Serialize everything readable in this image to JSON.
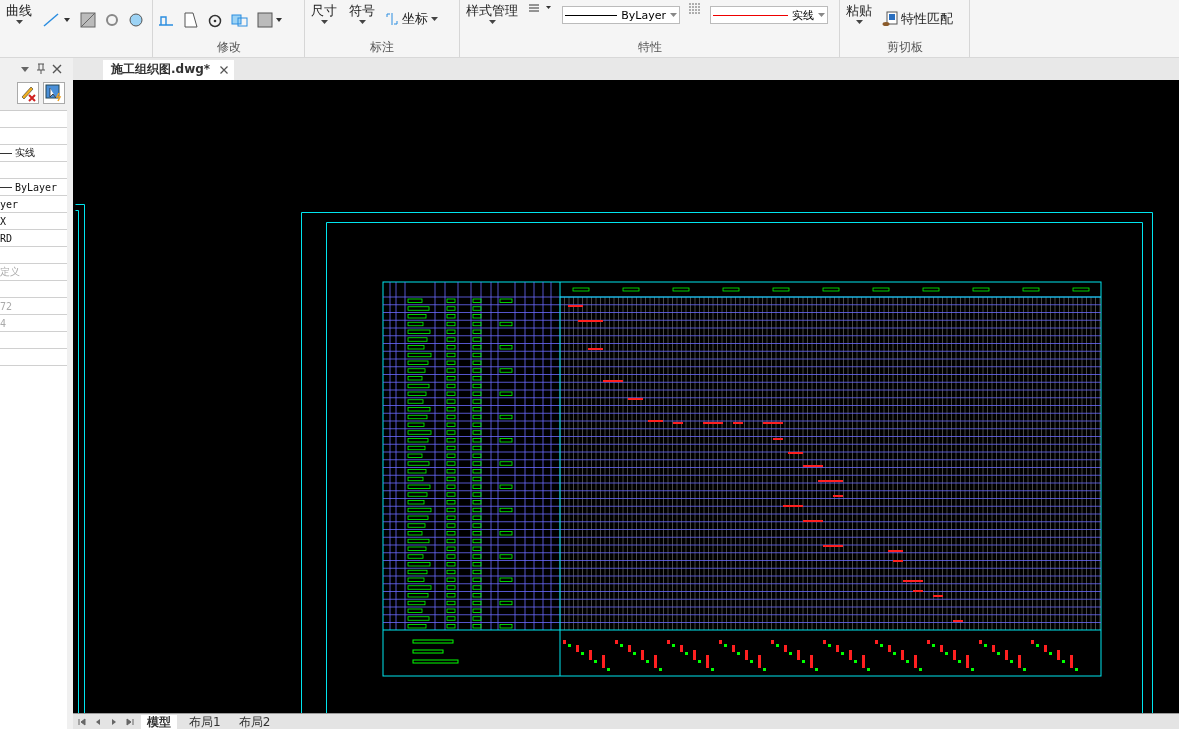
{
  "ribbon": {
    "groups": [
      {
        "kind": "draw",
        "big": "曲线"
      },
      {
        "kind": "modify",
        "label": "修改"
      },
      {
        "kind": "annotate",
        "label": "标注",
        "big": [
          "尺寸",
          "符号"
        ],
        "small": "坐标"
      },
      {
        "kind": "properties",
        "label": "特性",
        "big": "样式管理",
        "lineweight": "ByLayer",
        "linetype": "实线"
      },
      {
        "kind": "clipboard",
        "label": "剪切板",
        "big": "粘贴",
        "small": "特性匹配"
      }
    ]
  },
  "document_tab": {
    "title": "施工组织图.dwg*"
  },
  "properties_panel": {
    "rows": [
      {
        "kind": "blank"
      },
      {
        "kind": "blank"
      },
      {
        "kind": "line",
        "value": "实线",
        "muted": false
      },
      {
        "kind": "blank"
      },
      {
        "kind": "line",
        "value": "ByLayer",
        "muted": false
      },
      {
        "kind": "text",
        "value": "yer",
        "muted": false
      },
      {
        "kind": "text",
        "value": "X",
        "muted": false
      },
      {
        "kind": "text",
        "value": "RD",
        "muted": false
      },
      {
        "kind": "blank"
      },
      {
        "kind": "text",
        "value": "定义",
        "muted": true
      },
      {
        "kind": "blank"
      },
      {
        "kind": "text",
        "value": "72",
        "muted": true
      },
      {
        "kind": "text",
        "value": "4",
        "muted": true
      },
      {
        "kind": "blank"
      },
      {
        "kind": "blank"
      }
    ]
  },
  "layout_tabs": [
    {
      "label": "模型",
      "selected": true
    },
    {
      "label": "布局1",
      "selected": false
    },
    {
      "label": "布局2",
      "selected": false
    }
  ]
}
